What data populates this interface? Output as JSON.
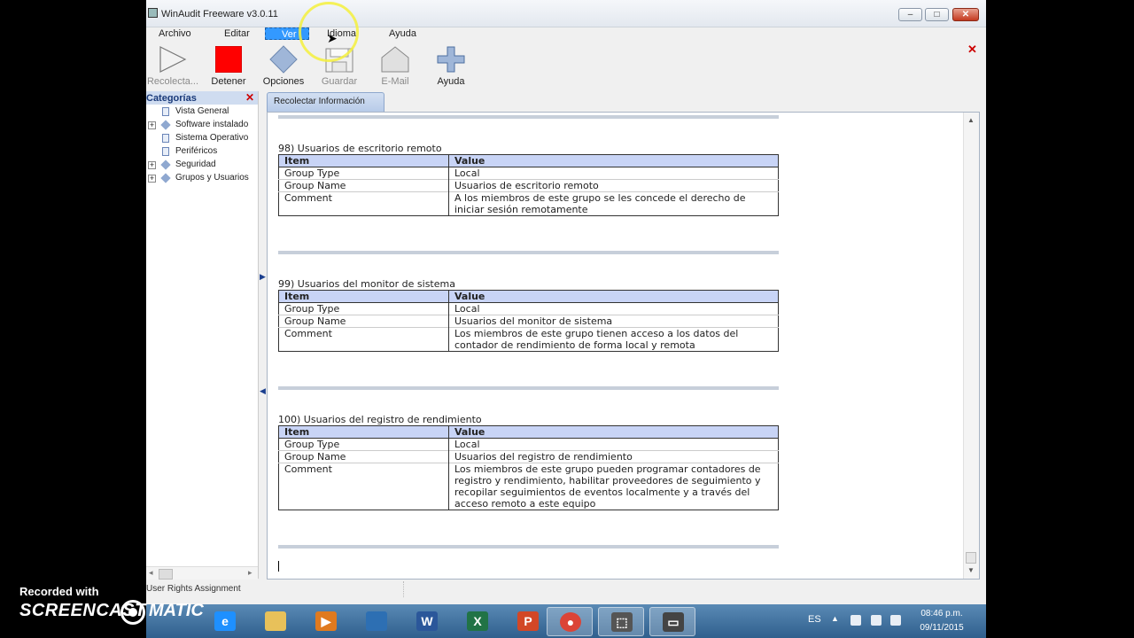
{
  "window": {
    "title": "WinAudit Freeware v3.0.11",
    "controls": {
      "minimize": "–",
      "maximize": "□",
      "close": "✕"
    }
  },
  "menu": [
    "Archivo",
    "Editar",
    "Ver",
    "Idioma",
    "Ayuda"
  ],
  "toolbar": {
    "recolectar": "Recolecta...",
    "detener": "Detener",
    "opciones": "Opciones",
    "guardar": "Guardar",
    "email": "E-Mail",
    "ayuda": "Ayuda"
  },
  "sidebar": {
    "title": "Categorías",
    "items": [
      {
        "label": "Vista General",
        "expandable": false,
        "icon": "document-icon"
      },
      {
        "label": "Software instalado",
        "expandable": true,
        "icon": "diamond-icon"
      },
      {
        "label": "Sistema Operativo",
        "expandable": false,
        "icon": "document-icon"
      },
      {
        "label": "Periféricos",
        "expandable": false,
        "icon": "document-icon"
      },
      {
        "label": "Seguridad",
        "expandable": true,
        "icon": "diamond-icon"
      },
      {
        "label": "Grupos y Usuarios",
        "expandable": true,
        "icon": "diamond-icon"
      }
    ]
  },
  "content": {
    "tab": "Recolectar Información",
    "groups": [
      {
        "title": "98) Usuarios de escritorio remoto",
        "headers": [
          "Item",
          "Value"
        ],
        "rows": [
          [
            "Group Type",
            "Local"
          ],
          [
            "Group Name",
            "Usuarios de escritorio remoto"
          ],
          [
            "Comment",
            "A los miembros de este grupo se les concede el derecho de iniciar sesión remotamente"
          ]
        ]
      },
      {
        "title": "99) Usuarios del monitor de sistema",
        "headers": [
          "Item",
          "Value"
        ],
        "rows": [
          [
            "Group Type",
            "Local"
          ],
          [
            "Group Name",
            "Usuarios del monitor de sistema"
          ],
          [
            "Comment",
            "Los miembros de este grupo tienen acceso a los datos del contador de rendimiento de forma local y remota"
          ]
        ]
      },
      {
        "title": "100) Usuarios del registro de rendimiento",
        "headers": [
          "Item",
          "Value"
        ],
        "rows": [
          [
            "Group Type",
            "Local"
          ],
          [
            "Group Name",
            "Usuarios del registro de rendimiento"
          ],
          [
            "Comment",
            "Los miembros de este grupo pueden programar contadores de registro y rendimiento, habilitar proveedores de seguimiento y recopilar seguimientos de eventos localmente y a través del acceso remoto a este equipo"
          ]
        ]
      }
    ]
  },
  "status": "User Rights Assignment",
  "taskbar": {
    "apps": [
      {
        "name": "internet-explorer-icon",
        "glyph": "e",
        "color": "#1e90ff",
        "active": false
      },
      {
        "name": "file-explorer-icon",
        "glyph": "",
        "color": "#e8c15a",
        "active": false
      },
      {
        "name": "media-player-icon",
        "glyph": "▶",
        "color": "#e07a1f",
        "active": false
      },
      {
        "name": "recycle-icon",
        "glyph": "",
        "color": "#2d6fb3",
        "active": false
      },
      {
        "name": "word-icon",
        "glyph": "W",
        "color": "#2b579a",
        "active": false
      },
      {
        "name": "excel-icon",
        "glyph": "X",
        "color": "#217346",
        "active": false
      },
      {
        "name": "powerpoint-icon",
        "glyph": "P",
        "color": "#d24726",
        "active": false
      },
      {
        "name": "chrome-icon",
        "glyph": "●",
        "color": "#db4437",
        "active": true
      },
      {
        "name": "snipping-tool-icon",
        "glyph": "⬚",
        "color": "#555555",
        "active": true
      },
      {
        "name": "winaudit-icon",
        "glyph": "▭",
        "color": "#444444",
        "active": true
      }
    ],
    "tray": {
      "lang": "ES",
      "time": "08:46 p.m.",
      "date": "09/11/2015"
    }
  },
  "watermark": {
    "line1": "Recorded with",
    "line2a": "SCREENCAST",
    "line2b": "MATIC"
  },
  "colors": {
    "menu_highlight": "#3399ff",
    "table_header": "#c8d4f6",
    "stop_red": "#ff0000"
  }
}
